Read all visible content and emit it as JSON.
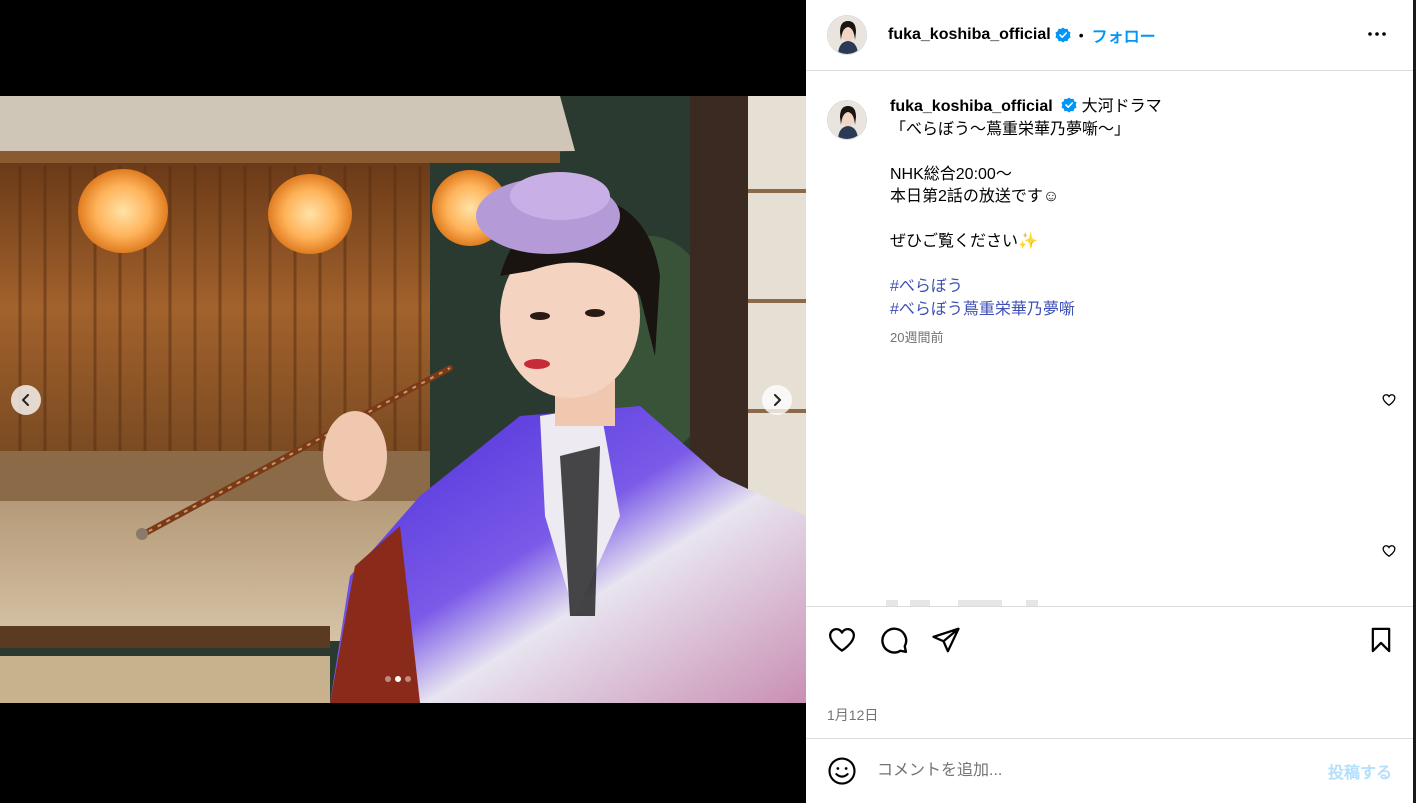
{
  "post": {
    "username": "fuka_koshiba_official",
    "separator": "•",
    "follow_label": "フォロー",
    "more_icon": "more-horizontal-icon",
    "verified_icon": "verified-badge-icon"
  },
  "caption": {
    "username": "fuka_koshiba_official",
    "lines": [
      "大河ドラマ",
      "「べらぼう～蔦重栄華乃夢噺～」",
      "",
      "NHK総合20:00～",
      "本日第2話の放送です☺",
      "",
      "ぜひご覧ください✨",
      ""
    ],
    "hashtags": [
      "#べらぼう",
      "#べらぼう蔦重栄華乃夢噺"
    ],
    "time": "20週間前"
  },
  "media": {
    "carousel_total": 3,
    "carousel_active": 2,
    "prev_icon": "chevron-left-icon",
    "next_icon": "chevron-right-icon"
  },
  "actions": {
    "like_icon": "heart-icon",
    "comment_icon": "comment-icon",
    "share_icon": "send-icon",
    "save_icon": "bookmark-icon",
    "date": "1月12日"
  },
  "comment": {
    "placeholder": "コメントを追加...",
    "post_label": "投稿する",
    "emoji_icon": "emoji-icon"
  },
  "colors": {
    "accent": "#0095f6",
    "hashtag": "#3f51b5",
    "muted": "#737373",
    "border": "#dbdbdb",
    "post_disabled": "#b2dffc"
  }
}
